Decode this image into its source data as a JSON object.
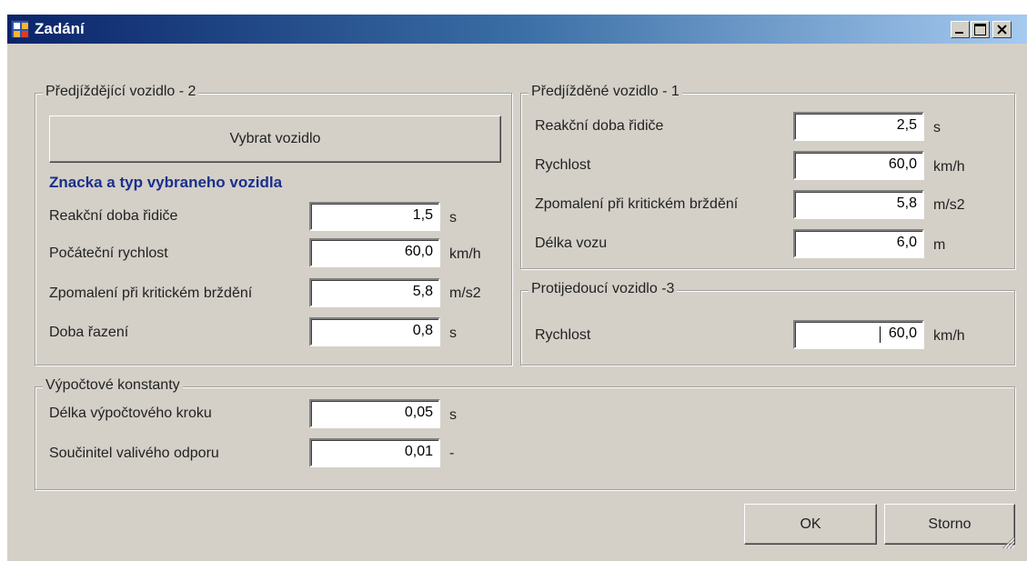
{
  "window": {
    "title": "Zadání"
  },
  "overtaking": {
    "title": "Předjíždějící vozidlo - 2",
    "select_button": "Vybrat vozidlo",
    "vehicle_name": "Znacka a typ vybraneho vozidla",
    "rows": [
      {
        "label": "Reakční doba řidiče",
        "value": "1,5",
        "unit": "s"
      },
      {
        "label": "Počáteční rychlost",
        "value": "60,0",
        "unit": "km/h"
      },
      {
        "label": "Zpomalení při kritickém brždění",
        "value": "5,8",
        "unit": "m/s2"
      },
      {
        "label": "Doba řazení",
        "value": "0,8",
        "unit": "s"
      }
    ]
  },
  "overtaken": {
    "title": "Předjížděné vozidlo - 1",
    "rows": [
      {
        "label": "Reakční doba řidiče",
        "value": "2,5",
        "unit": "s"
      },
      {
        "label": "Rychlost",
        "value": "60,0",
        "unit": "km/h"
      },
      {
        "label": "Zpomalení při kritickém brždění",
        "value": "5,8",
        "unit": "m/s2"
      },
      {
        "label": "Délka vozu",
        "value": "6,0",
        "unit": "m"
      }
    ]
  },
  "oncoming": {
    "title": "Protijedoucí vozidlo -3",
    "rows": [
      {
        "label": "Rychlost",
        "value": "60,0",
        "unit": "km/h"
      }
    ]
  },
  "constants": {
    "title": "Výpočtové konstanty",
    "rows": [
      {
        "label": "Délka výpočtového kroku",
        "value": "0,05",
        "unit": "s"
      },
      {
        "label": "Součinitel valivého odporu",
        "value": "0,01",
        "unit": "-"
      }
    ]
  },
  "buttons": {
    "ok": "OK",
    "cancel": "Storno"
  }
}
